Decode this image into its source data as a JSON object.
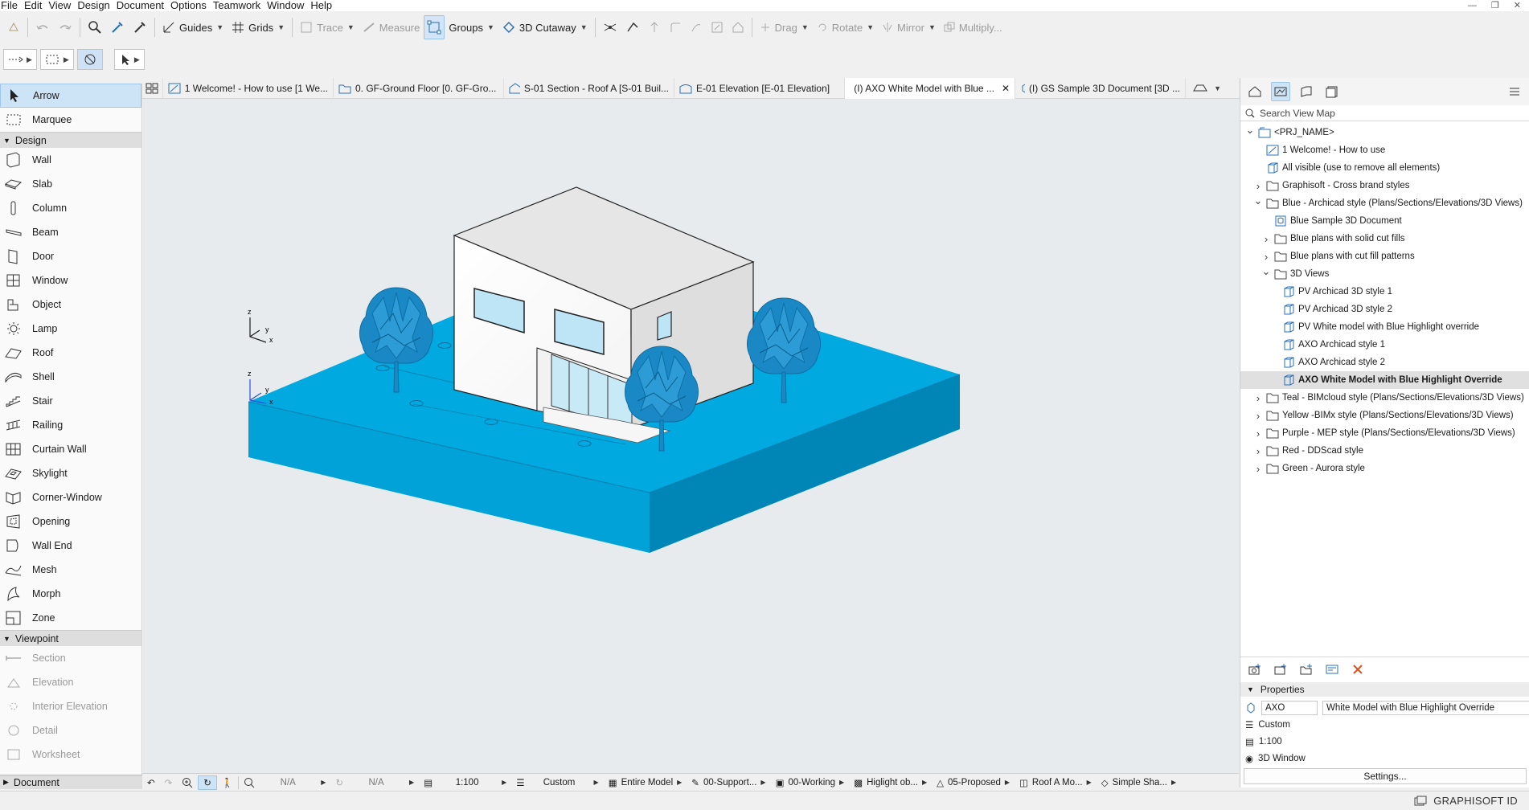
{
  "menubar": [
    "File",
    "Edit",
    "View",
    "Design",
    "Document",
    "Options",
    "Teamwork",
    "Window",
    "Help"
  ],
  "toolbar": {
    "guides": "Guides",
    "grids": "Grids",
    "trace": "Trace",
    "measure": "Measure",
    "groups": "Groups",
    "cutaway": "3D Cutaway",
    "drag": "Drag",
    "rotate": "Rotate",
    "mirror": "Mirror",
    "multiply": "Multiply..."
  },
  "toolbox": {
    "top": [
      "Arrow",
      "Marquee"
    ],
    "design_header": "Design",
    "design": [
      {
        "label": "Wall",
        "icon": "wall-icon"
      },
      {
        "label": "Slab",
        "icon": "slab-icon"
      },
      {
        "label": "Column",
        "icon": "column-icon"
      },
      {
        "label": "Beam",
        "icon": "beam-icon"
      },
      {
        "label": "Door",
        "icon": "door-icon"
      },
      {
        "label": "Window",
        "icon": "window-icon"
      },
      {
        "label": "Object",
        "icon": "object-icon"
      },
      {
        "label": "Lamp",
        "icon": "lamp-icon"
      },
      {
        "label": "Roof",
        "icon": "roof-icon"
      },
      {
        "label": "Shell",
        "icon": "shell-icon"
      },
      {
        "label": "Stair",
        "icon": "stair-icon"
      },
      {
        "label": "Railing",
        "icon": "railing-icon"
      },
      {
        "label": "Curtain Wall",
        "icon": "curtain-wall-icon"
      },
      {
        "label": "Skylight",
        "icon": "skylight-icon"
      },
      {
        "label": "Corner-Window",
        "icon": "corner-window-icon"
      },
      {
        "label": "Opening",
        "icon": "opening-icon"
      },
      {
        "label": "Wall End",
        "icon": "wall-end-icon"
      },
      {
        "label": "Mesh",
        "icon": "mesh-icon"
      },
      {
        "label": "Morph",
        "icon": "morph-icon"
      },
      {
        "label": "Zone",
        "icon": "zone-icon"
      }
    ],
    "viewpoint_header": "Viewpoint",
    "viewpoint": [
      "Section",
      "Elevation",
      "Interior Elevation",
      "Detail",
      "Worksheet"
    ],
    "document_header": "Document"
  },
  "tabs": [
    "1 Welcome! - How to use [1 We...",
    "0. GF-Ground Floor [0. GF-Gro...",
    "S-01 Section - Roof A [S-01 Buil...",
    "E-01 Elevation [E-01 Elevation]",
    "(I) AXO White Model with Blue ...",
    "(I) GS Sample 3D Document [3D ..."
  ],
  "axes": {
    "z": "z",
    "y": "y",
    "x": "x"
  },
  "statusbar": {
    "na1": "N/A",
    "na2": "N/A",
    "scale": "1:100",
    "custom": "Custom",
    "model": "Entire Model",
    "support": "00-Support...",
    "working": "00-Working",
    "highlight": "Higlight ob...",
    "proposed": "05-Proposed",
    "roof": "Roof A Mo...",
    "shading": "Simple Sha..."
  },
  "navigator": {
    "search_placeholder": "Search View Map",
    "tree": [
      {
        "label": "<PRJ_NAME>",
        "level": 0,
        "toggle": "open",
        "icon": "project"
      },
      {
        "label": "1 Welcome! - How to use",
        "level": 1,
        "toggle": "",
        "icon": "view"
      },
      {
        "label": "All visible (use to remove all elements)",
        "level": 1,
        "toggle": "",
        "icon": "view3d"
      },
      {
        "label": "Graphisoft - Cross brand styles",
        "level": 1,
        "toggle": "closed",
        "icon": "folder"
      },
      {
        "label": "Blue - Archicad style (Plans/Sections/Elevations/3D Views)",
        "level": 1,
        "toggle": "open",
        "icon": "folder"
      },
      {
        "label": "Blue Sample 3D Document",
        "level": 2,
        "toggle": "",
        "icon": "doc3d"
      },
      {
        "label": "Blue plans with solid cut fills",
        "level": 2,
        "toggle": "closed",
        "icon": "folder"
      },
      {
        "label": "Blue plans with cut fill patterns",
        "level": 2,
        "toggle": "closed",
        "icon": "folder"
      },
      {
        "label": "3D Views",
        "level": 2,
        "toggle": "open",
        "icon": "folder"
      },
      {
        "label": "PV Archicad 3D style 1",
        "level": 3,
        "toggle": "",
        "icon": "view3d"
      },
      {
        "label": "PV Archicad 3D style 2",
        "level": 3,
        "toggle": "",
        "icon": "view3d"
      },
      {
        "label": "PV White model with Blue Highlight override",
        "level": 3,
        "toggle": "",
        "icon": "view3d"
      },
      {
        "label": "AXO Archicad style 1",
        "level": 3,
        "toggle": "",
        "icon": "view3d"
      },
      {
        "label": "AXO Archicad style 2",
        "level": 3,
        "toggle": "",
        "icon": "view3d"
      },
      {
        "label": "AXO White Model with Blue Highlight Override",
        "level": 3,
        "toggle": "",
        "icon": "view3d",
        "selected": true
      },
      {
        "label": "Teal - BIMcloud style (Plans/Sections/Elevations/3D Views)",
        "level": 1,
        "toggle": "closed",
        "icon": "folder"
      },
      {
        "label": "Yellow -BIMx style (Plans/Sections/Elevations/3D Views)",
        "level": 1,
        "toggle": "closed",
        "icon": "folder"
      },
      {
        "label": "Purple - MEP style (Plans/Sections/Elevations/3D Views)",
        "level": 1,
        "toggle": "closed",
        "icon": "folder"
      },
      {
        "label": "Red - DDScad style",
        "level": 1,
        "toggle": "closed",
        "icon": "folder"
      },
      {
        "label": "Green - Aurora style",
        "level": 1,
        "toggle": "closed",
        "icon": "folder"
      }
    ],
    "properties": {
      "header": "Properties",
      "id": "AXO",
      "name": "White Model with Blue Highlight Override",
      "layer_combo": "Custom",
      "scale": "1:100",
      "context": "3D Window",
      "settings": "Settings..."
    }
  },
  "brand": "GRAPHISOFT ID",
  "colors": {
    "accent": "#0099d8",
    "ground_top": "#00a9e0",
    "ground_front": "#00a0d6",
    "ground_side": "#0088b8",
    "tree": "#1a88c4",
    "selection": "#cde4f7"
  }
}
